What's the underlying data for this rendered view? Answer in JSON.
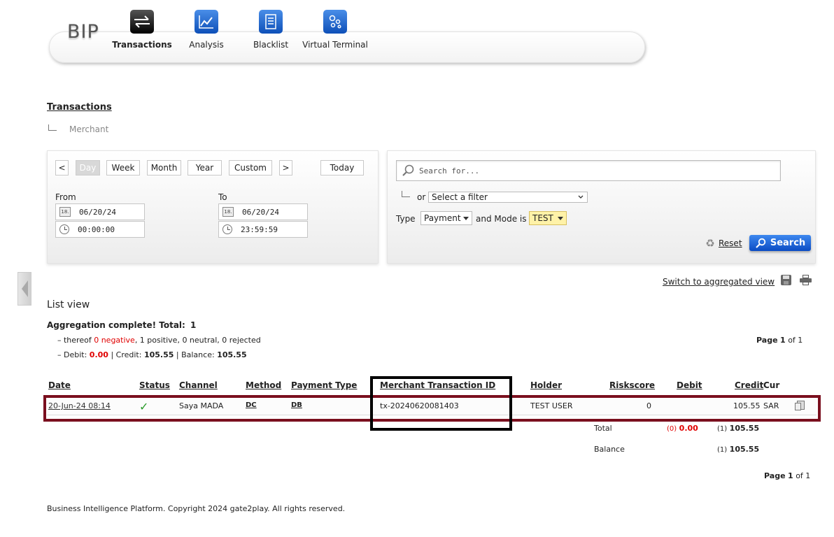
{
  "app": {
    "logo": "BIP"
  },
  "nav": [
    {
      "label": "Transactions",
      "icon": "transactions-icon",
      "active": true
    },
    {
      "label": "Analysis",
      "icon": "analysis-chart-icon",
      "active": false
    },
    {
      "label": "Blacklist",
      "icon": "blacklist-document-icon",
      "active": false
    },
    {
      "label": "Virtual Terminal",
      "icon": "virtual-terminal-icon",
      "active": false
    }
  ],
  "breadcrumb": {
    "title": "Transactions",
    "sub": "Merchant"
  },
  "date_panel": {
    "prev": "<",
    "next": ">",
    "periods": [
      "Day",
      "Week",
      "Month",
      "Year",
      "Custom"
    ],
    "active_period": "Day",
    "today": "Today",
    "from_label": "From",
    "to_label": "To",
    "from_date": "06/20/24",
    "from_time": "00:00:00",
    "to_date": "06/20/24",
    "to_time": "23:59:59",
    "cal_icon_text": "18."
  },
  "filter_panel": {
    "search_placeholder": "Search for...",
    "or_label": "or",
    "filter_select": "Select a filter",
    "type_label": "Type",
    "type_value": "Payment",
    "mode_label": "and Mode is",
    "mode_value": "TEST",
    "reset": "Reset",
    "search": "Search"
  },
  "toolbar": {
    "switch_view": "Switch to aggregated view",
    "dot": "·"
  },
  "list": {
    "heading": "List view",
    "aggregation_label": "Aggregation complete! Total:",
    "aggregation_total": "1",
    "thereof_prefix": "– thereof",
    "negative": "0 negative",
    "rest": ", 1 positive, 0 neutral, 0 rejected",
    "debit_prefix": "– Debit:",
    "debit_value": "0.00",
    "credit_label": "| Credit:",
    "credit_value": "105.55",
    "balance_label": "| Balance:",
    "balance_value": "105.55",
    "page_word": "Page",
    "page_num": "1",
    "page_of": "of 1"
  },
  "table": {
    "columns": [
      "Date",
      "Status",
      "Channel",
      "Method",
      "Payment Type",
      "Merchant Transaction ID",
      "Holder",
      "Riskscore",
      "Debit",
      "Credit",
      "Cur"
    ],
    "row": {
      "date": "20-Jun-24 08:14",
      "status": "✓",
      "channel": "Saya MADA",
      "method": "DC",
      "payment_type": "DB",
      "merchant_tx_id": "tx-20240620081403",
      "holder": "TEST USER",
      "riskscore": "0",
      "debit": "",
      "credit": "105.55",
      "cur": "SAR"
    },
    "total_label": "Total",
    "total_debit_count": "(0)",
    "total_debit": "0.00",
    "total_credit_count": "(1)",
    "total_credit": "105.55",
    "balance_label": "Balance",
    "balance_count": "(1)",
    "balance_value": "105.55"
  },
  "footer": "Business Intelligence Platform. Copyright 2024 gate2play. All rights reserved.",
  "colors": {
    "accent_blue": "#1058d0",
    "negative_red": "#e00000",
    "highlight_row": "#7a0f1e",
    "highlight_column": "#000000",
    "mode_bg": "#fff2a8"
  }
}
